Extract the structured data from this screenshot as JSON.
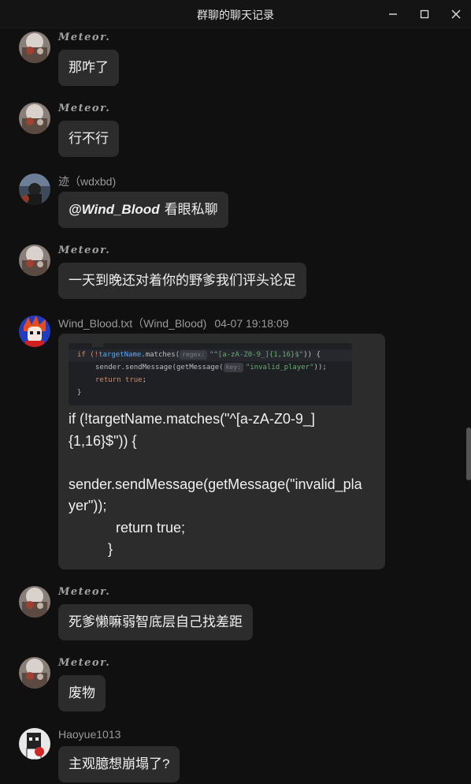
{
  "window": {
    "title": "群聊的聊天记录",
    "controls": {
      "minimize": "minimize-icon",
      "maximize": "maximize-icon",
      "close": "close-icon"
    }
  },
  "colors": {
    "background": "#101010",
    "bubble": "#2c2c2c",
    "name": "#9a9a9a",
    "text": "#f0f0f0"
  },
  "messages": [
    {
      "sender": "Meteor.",
      "text": "那咋了"
    },
    {
      "sender": "Meteor.",
      "text": "行不行"
    },
    {
      "sender": "迹（wdxbd)",
      "mention": "@Wind_Blood",
      "text": "看眼私聊"
    },
    {
      "sender": "Meteor.",
      "text": "一天到晚还对着你的野爹我们评头论足"
    },
    {
      "sender": "Wind_Blood.txt（Wind_Blood)",
      "time": "04-07 19:18:09",
      "code_image": {
        "line1_a": "if (!",
        "line1_var": "targetName",
        "line1_b": ".matches(",
        "line1_hint": "regex:",
        "line1_str": "\"^[a-zA-Z0-9_]{1,16}$\"",
        "line1_c": ")) {",
        "line2_a": "sender.sendMessage(getMessage(",
        "line2_hint": "key:",
        "line2_str": "\"invalid_player\"",
        "line2_c": "));",
        "line3_kw": "return true",
        "line3_c": ";",
        "line4": "}"
      },
      "text_lines": [
        "if (!targetName.matches(\"^[a-zA-Z0-9_]",
        "{1,16}$\")) {",
        "",
        "sender.sendMessage(getMessage(\"invalid_pla",
        "yer\"));",
        "            return true;",
        "          }"
      ]
    },
    {
      "sender": "Meteor.",
      "text": "死爹懒嘛弱智底层自己找差距"
    },
    {
      "sender": "Meteor.",
      "text": "废物"
    },
    {
      "sender": "Haoyue1013",
      "text": "主观臆想崩塌了?"
    }
  ]
}
